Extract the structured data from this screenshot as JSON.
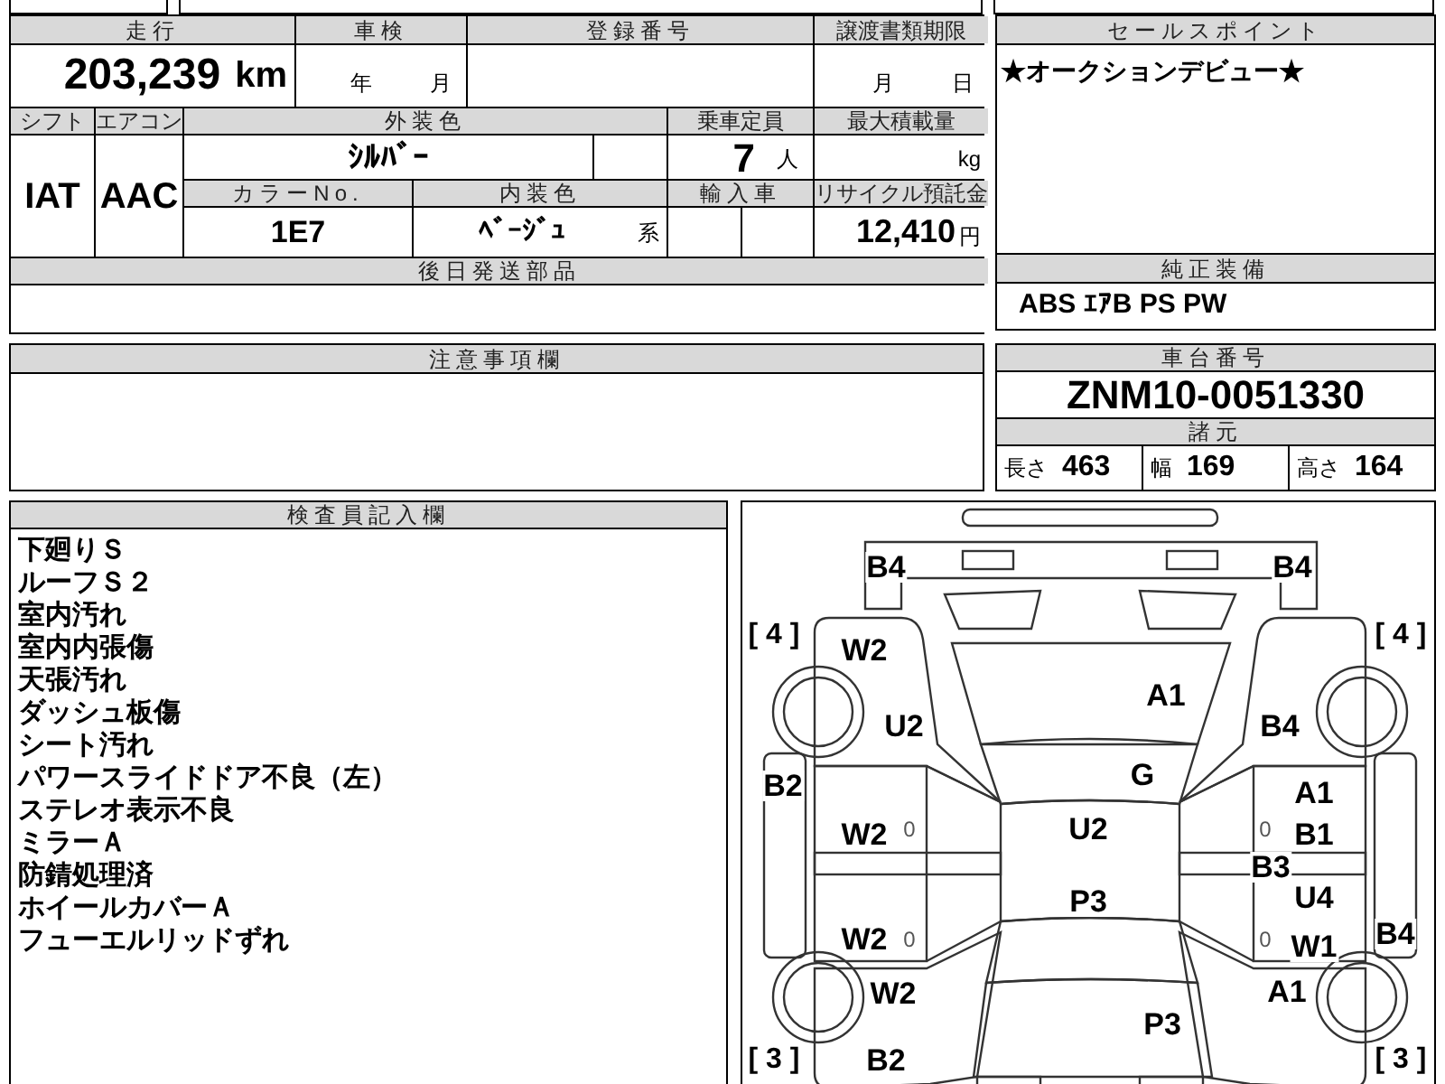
{
  "top_table": {
    "mileage": {
      "label": "走行",
      "value": "203,239",
      "unit": "km"
    },
    "inspection": {
      "label": "車検",
      "year_unit": "年",
      "month_unit": "月"
    },
    "registration": {
      "label": "登録番号"
    },
    "transfer_deadline": {
      "label": "譲渡書類期限",
      "month_unit": "月",
      "day_unit": "日"
    },
    "shift": {
      "label": "シフト",
      "value": "IAT"
    },
    "aircon": {
      "label": "エアコン",
      "value": "AAC"
    },
    "exterior_color": {
      "label": "外装色",
      "value": "ｼﾙﾊﾞｰ"
    },
    "capacity": {
      "label": "乗車定員",
      "value": "7",
      "unit": "人"
    },
    "max_load": {
      "label": "最大積載量",
      "unit": "kg"
    },
    "color_no": {
      "label": "カラーNo.",
      "value": "1E7"
    },
    "interior_color": {
      "label": "内装色",
      "value": "ﾍﾞｰｼﾞｭ",
      "suffix": "系"
    },
    "import": {
      "label": "輸入車"
    },
    "recycle_fee": {
      "label": "リサイクル預託金",
      "value": "12,410",
      "unit": "円"
    },
    "later_parts": {
      "label": "後日発送部品"
    }
  },
  "sales_point": {
    "label": "セールスポイント",
    "text": "★オークションデビュー★"
  },
  "standard_equipment": {
    "label": "純正装備",
    "value": "ABS ｴｱB PS PW"
  },
  "notes": {
    "label": "注意事項欄"
  },
  "chassis": {
    "label": "車台番号",
    "value": "ZNM10-0051330"
  },
  "specs": {
    "label": "諸元",
    "items": [
      {
        "label": "長さ",
        "value": "463"
      },
      {
        "label": "幅",
        "value": "169"
      },
      {
        "label": "高さ",
        "value": "164"
      }
    ]
  },
  "inspector_notes": {
    "label": "検査員記入欄",
    "lines": [
      "下廻りＳ",
      "ルーフＳ２",
      "室内汚れ",
      "室内内張傷",
      "天張汚れ",
      "ダッシュ板傷",
      "シート汚れ",
      "パワースライドドア不良（左）",
      "ステレオ表示不良",
      "ミラーＡ",
      "防錆処理済",
      "ホイールカバーＡ",
      "フューエルリッドずれ"
    ]
  },
  "diagram": {
    "marks": [
      {
        "kind": "code",
        "text": "B4"
      },
      {
        "kind": "code",
        "text": "B4"
      },
      {
        "kind": "tire",
        "text": "[ 4 ]"
      },
      {
        "kind": "tire",
        "text": "[ 4 ]"
      },
      {
        "kind": "code",
        "text": "W2"
      },
      {
        "kind": "code",
        "text": "A1"
      },
      {
        "kind": "code",
        "text": "U2"
      },
      {
        "kind": "code",
        "text": "B4"
      },
      {
        "kind": "code",
        "text": "G"
      },
      {
        "kind": "code",
        "text": "B2"
      },
      {
        "kind": "code",
        "text": "A1"
      },
      {
        "kind": "code",
        "text": "W2"
      },
      {
        "kind": "small",
        "text": "0"
      },
      {
        "kind": "code",
        "text": "U2"
      },
      {
        "kind": "small",
        "text": "0"
      },
      {
        "kind": "code",
        "text": "B1"
      },
      {
        "kind": "code",
        "text": "B3"
      },
      {
        "kind": "code",
        "text": "U4"
      },
      {
        "kind": "code",
        "text": "P3"
      },
      {
        "kind": "code",
        "text": "W2"
      },
      {
        "kind": "small",
        "text": "0"
      },
      {
        "kind": "small",
        "text": "0"
      },
      {
        "kind": "code",
        "text": "W1"
      },
      {
        "kind": "code",
        "text": "B4"
      },
      {
        "kind": "code",
        "text": "W2"
      },
      {
        "kind": "code",
        "text": "A1"
      },
      {
        "kind": "code",
        "text": "P3"
      },
      {
        "kind": "tire",
        "text": "[ 3 ]"
      },
      {
        "kind": "code",
        "text": "B2"
      },
      {
        "kind": "tire",
        "text": "[ 3 ]"
      }
    ]
  }
}
